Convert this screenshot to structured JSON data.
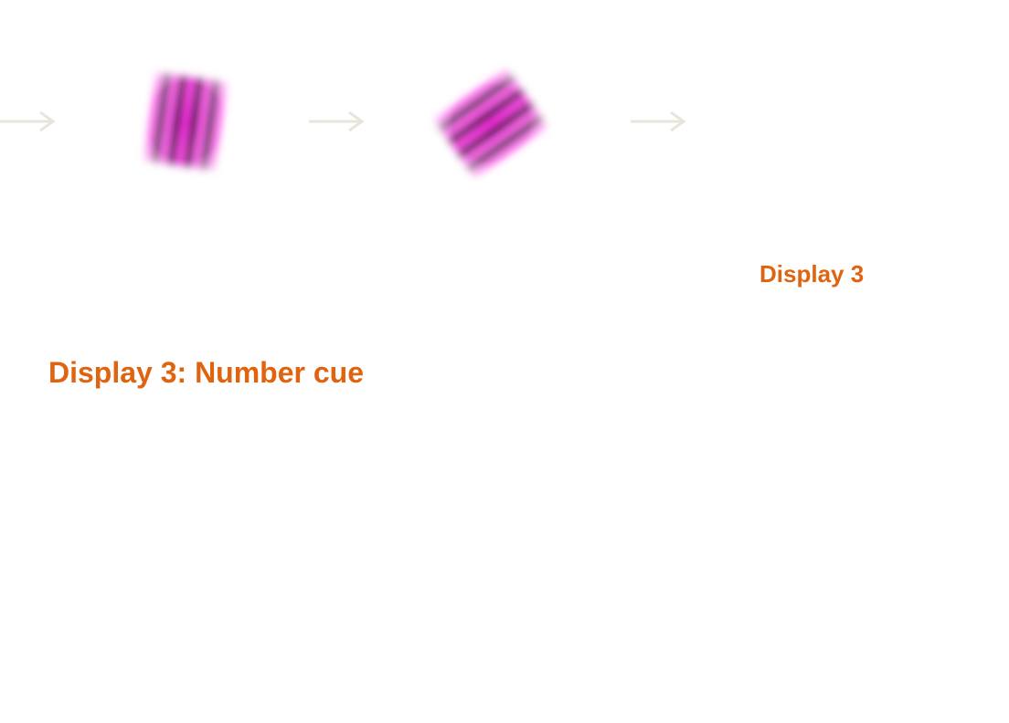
{
  "colors": {
    "accent_text": "#e0640f",
    "arrow": "#e8e6dc",
    "stripe_dark": "#111111",
    "stripe_bright": "#ff2ee6"
  },
  "stimuli": [
    {
      "name": "vertical-gabor",
      "orientation_deg": 8
    },
    {
      "name": "oblique-gabor",
      "orientation_deg": 55
    }
  ],
  "display_label": "Display 3",
  "caption": "Display 3: Number cue"
}
